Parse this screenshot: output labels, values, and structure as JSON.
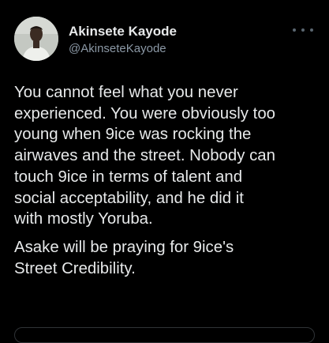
{
  "user": {
    "display_name": "Akinsete Kayode",
    "handle": "@AkinseteKayode"
  },
  "tweet": {
    "paragraph_1": [
      "You cannot feel what you never",
      "experienced. You were obviously too",
      "young when 9ice was rocking the",
      "airwaves and the street. Nobody can",
      "touch 9ice in terms of talent and",
      "social acceptability, and he did it",
      "with mostly Yoruba."
    ],
    "paragraph_2": [
      "Asake will be praying for 9ice's",
      "Street Credibility."
    ]
  },
  "icons": {
    "avatar": "user-avatar-photo",
    "more": "more-options-icon"
  },
  "colors": {
    "background": "#000000",
    "text": "#e7e9ea",
    "secondary_text": "#8b98a5"
  }
}
